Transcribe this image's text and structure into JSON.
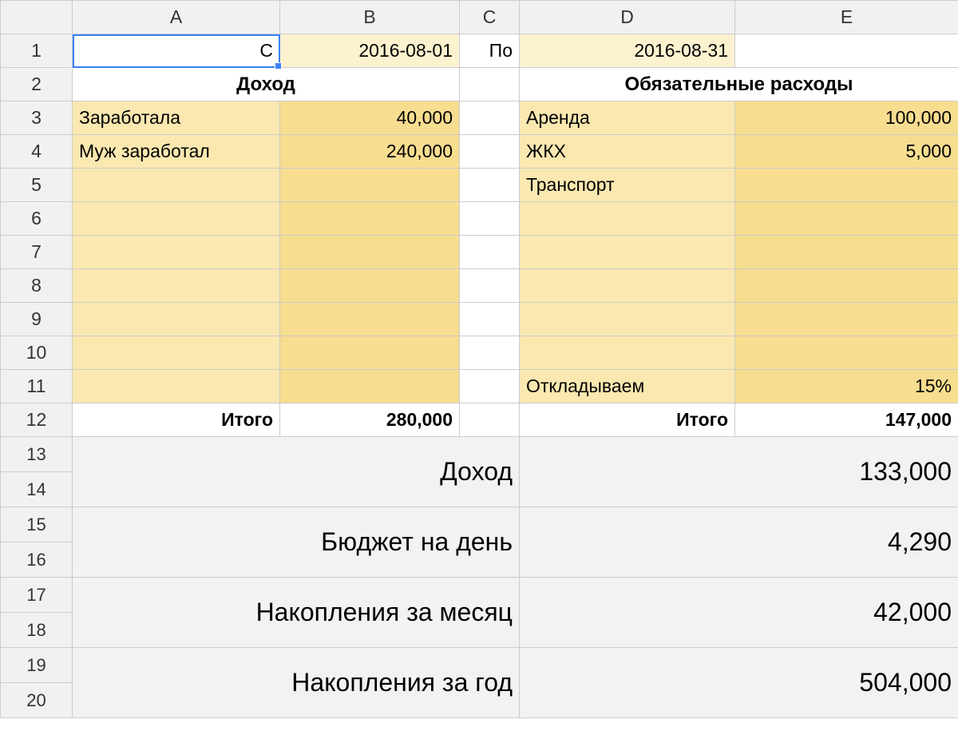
{
  "columns": [
    "A",
    "B",
    "C",
    "D",
    "E"
  ],
  "rownums": [
    "1",
    "2",
    "3",
    "4",
    "5",
    "6",
    "7",
    "8",
    "9",
    "10",
    "11",
    "12",
    "13",
    "14",
    "15",
    "16",
    "17",
    "18",
    "19",
    "20"
  ],
  "r1": {
    "a": "С",
    "b": "2016-08-01",
    "c": "По",
    "d": "2016-08-31"
  },
  "r2": {
    "income_header": "Доход",
    "expense_header": "Обязательные расходы"
  },
  "income": {
    "items": [
      {
        "label": "Заработала",
        "value": "40,000"
      },
      {
        "label": "Муж заработал",
        "value": "240,000"
      }
    ],
    "total_label": "Итого",
    "total_value": "280,000"
  },
  "expenses": {
    "items": [
      {
        "label": "Аренда",
        "value": "100,000"
      },
      {
        "label": "ЖКХ",
        "value": "5,000"
      },
      {
        "label": "Транспорт",
        "value": ""
      }
    ],
    "save_label": "Откладываем",
    "save_value": "15%",
    "total_label": "Итого",
    "total_value": "147,000"
  },
  "summary": [
    {
      "label": "Доход",
      "value": "133,000"
    },
    {
      "label": "Бюджет на день",
      "value": "4,290"
    },
    {
      "label": "Накопления за месяц",
      "value": "42,000"
    },
    {
      "label": "Накопления за год",
      "value": "504,000"
    }
  ]
}
